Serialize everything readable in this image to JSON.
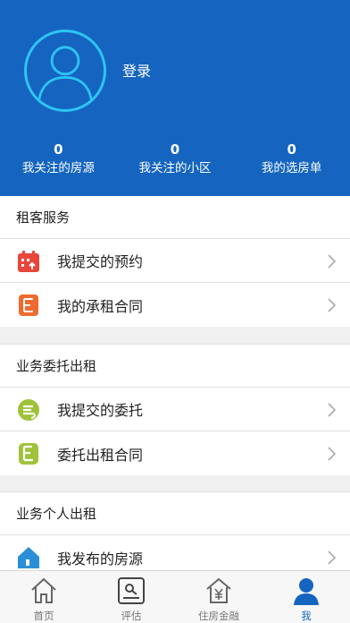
{
  "header": {
    "login_label": "登录",
    "stats": [
      {
        "value": "0",
        "label": "我关注的房源"
      },
      {
        "value": "0",
        "label": "我关注的小区"
      },
      {
        "value": "0",
        "label": "我的选房单"
      }
    ]
  },
  "sections": [
    {
      "title": "租客服务",
      "items": [
        {
          "label": "我提交的预约",
          "icon": "calendar-icon"
        },
        {
          "label": "我的承租合同",
          "icon": "contract-icon"
        }
      ]
    },
    {
      "title": "业务委托出租",
      "items": [
        {
          "label": "我提交的委托",
          "icon": "entrust-icon"
        },
        {
          "label": "委托出租合同",
          "icon": "entrust-contract-icon"
        }
      ]
    },
    {
      "title": "业务个人出租",
      "items": [
        {
          "label": "我发布的房源",
          "icon": "house-icon"
        }
      ]
    }
  ],
  "tabbar": {
    "tabs": [
      {
        "label": "首页",
        "icon": "home-icon"
      },
      {
        "label": "评估",
        "icon": "assess-icon"
      },
      {
        "label": "住房金融",
        "icon": "finance-icon"
      },
      {
        "label": "我",
        "icon": "profile-icon"
      }
    ],
    "active_index": 3
  },
  "colors": {
    "header_bg": "#1565c0",
    "avatar_ring": "#2ec4f5",
    "red_icon": "#e8463a",
    "orange_icon": "#ee6a2e",
    "green_icon": "#9fc23a",
    "blue_icon": "#2a8fd6"
  }
}
